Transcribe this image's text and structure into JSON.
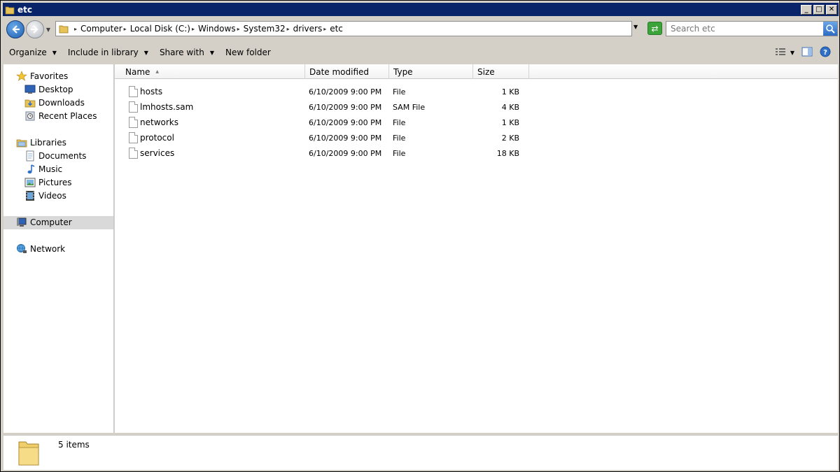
{
  "window": {
    "title": "etc",
    "minimize_glyph": "_",
    "maximize_glyph": "□",
    "close_glyph": "✕"
  },
  "address": {
    "crumbs": [
      "Computer",
      "Local Disk (C:)",
      "Windows",
      "System32",
      "drivers",
      "etc"
    ],
    "search_placeholder": "Search etc"
  },
  "toolbar": {
    "organize": "Organize",
    "include_in_library": "Include in library",
    "share_with": "Share with",
    "new_folder": "New folder"
  },
  "nav": {
    "favorites": "Favorites",
    "favorites_items": [
      "Desktop",
      "Downloads",
      "Recent Places"
    ],
    "libraries": "Libraries",
    "libraries_items": [
      "Documents",
      "Music",
      "Pictures",
      "Videos"
    ],
    "computer": "Computer",
    "network": "Network"
  },
  "columns": {
    "name": "Name",
    "date_modified": "Date modified",
    "type": "Type",
    "size": "Size"
  },
  "files": [
    {
      "name": "hosts",
      "date": "6/10/2009 9:00 PM",
      "type": "File",
      "size": "1 KB"
    },
    {
      "name": "lmhosts.sam",
      "date": "6/10/2009 9:00 PM",
      "type": "SAM File",
      "size": "4 KB"
    },
    {
      "name": "networks",
      "date": "6/10/2009 9:00 PM",
      "type": "File",
      "size": "1 KB"
    },
    {
      "name": "protocol",
      "date": "6/10/2009 9:00 PM",
      "type": "File",
      "size": "2 KB"
    },
    {
      "name": "services",
      "date": "6/10/2009 9:00 PM",
      "type": "File",
      "size": "18 KB"
    }
  ],
  "status": {
    "item_count": "5 items"
  }
}
